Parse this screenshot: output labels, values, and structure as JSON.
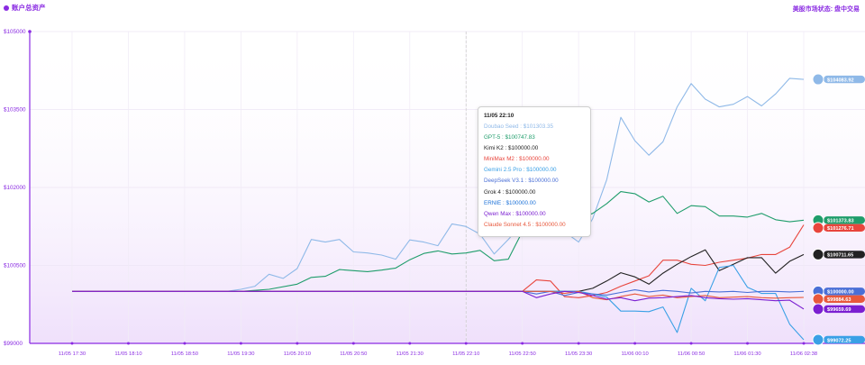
{
  "header": {
    "title": "账户总资产",
    "market_status": "美股市场状态: 盘中交易"
  },
  "tooltip": {
    "time": "11/05 22:10",
    "rows": [
      {
        "label": "Doubao Seed : $101303.35",
        "color": "#8fb9e8"
      },
      {
        "label": "GPT-5 : $100747.83",
        "color": "#1f9d6b"
      },
      {
        "label": "Kimi K2 : $100000.00",
        "color": "#222222"
      },
      {
        "label": "MiniMax M2 : $100000.00",
        "color": "#e8453c"
      },
      {
        "label": "Gemini 2.5 Pro : $100000.00",
        "color": "#3aa0e6"
      },
      {
        "label": "DeepSeek V3.1 : $100000.00",
        "color": "#4a6fd6"
      },
      {
        "label": "Grok 4 : $100000.00",
        "color": "#222222"
      },
      {
        "label": "ERNIE : $100000.00",
        "color": "#1e73d8"
      },
      {
        "label": "Qwen Max : $100000.00",
        "color": "#7b1fd1"
      },
      {
        "label": "Claude Sonnet 4.5 : $100000.00",
        "color": "#e8583c"
      }
    ]
  },
  "chart_data": {
    "type": "line",
    "ylim": [
      99000,
      105000
    ],
    "y_ticks": [
      "$105000",
      "$103500",
      "$102000",
      "$100500",
      "$99000"
    ],
    "x_ticks": [
      "11/05 17:30",
      "11/05 18:10",
      "11/05 18:50",
      "11/05 19:30",
      "11/05 20:10",
      "11/05 20:50",
      "11/05 21:30",
      "11/05 22:10",
      "11/05 22:50",
      "11/05 23:30",
      "11/06 00:10",
      "11/06 00:50",
      "11/06 01:30",
      "11/06 02:38"
    ],
    "series": [
      {
        "name": "Doubao Seed",
        "color": "#8fb9e8",
        "end_label": "$104083.92",
        "badge": "avatar",
        "x": [
          0,
          2.75,
          3,
          3.25,
          3.5,
          3.75,
          4,
          4.25,
          4.5,
          4.75,
          5,
          5.25,
          5.5,
          5.75,
          6,
          6.25,
          6.5,
          6.75,
          7,
          7.25,
          7.5,
          7.75,
          8,
          8.25,
          8.5,
          8.75,
          9,
          9.25,
          9.5,
          9.75,
          10,
          10.25,
          10.5,
          10.75,
          11,
          11.25,
          11.5,
          11.75,
          12,
          12.25,
          12.5,
          12.75,
          13
        ],
        "y": [
          100000,
          100000,
          100040,
          100100,
          100330,
          100250,
          100440,
          101000,
          100950,
          101000,
          100760,
          100740,
          100700,
          100620,
          100990,
          100950,
          100880,
          101300,
          101250,
          101100,
          100720,
          101000,
          101300,
          101280,
          101350,
          101150,
          100950,
          101400,
          102150,
          103350,
          102900,
          102620,
          102880,
          103550,
          104000,
          103700,
          103550,
          103600,
          103750,
          103570,
          103800,
          104100,
          104080
        ]
      },
      {
        "name": "GPT-5",
        "color": "#1f9d6b",
        "end_label": "$101373.83",
        "x": [
          0,
          3,
          3.5,
          4,
          4.25,
          4.5,
          4.75,
          5,
          5.25,
          5.5,
          5.75,
          6,
          6.25,
          6.5,
          6.75,
          7,
          7.25,
          7.5,
          7.75,
          8,
          8.25,
          8.5,
          8.75,
          9,
          9.25,
          9.5,
          9.75,
          10,
          10.25,
          10.5,
          10.75,
          11,
          11.25,
          11.5,
          11.75,
          12,
          12.25,
          12.5,
          12.75,
          13
        ],
        "y": [
          100000,
          100000,
          100040,
          100140,
          100270,
          100290,
          100420,
          100400,
          100380,
          100410,
          100450,
          100610,
          100730,
          100780,
          100720,
          100740,
          100790,
          100590,
          100620,
          101150,
          101300,
          101350,
          101380,
          101410,
          101500,
          101690,
          101920,
          101880,
          101720,
          101830,
          101500,
          101650,
          101630,
          101450,
          101450,
          101430,
          101500,
          101380,
          101340,
          101370
        ]
      },
      {
        "name": "MiniMax M2",
        "color": "#e8453c",
        "end_label": "$101276.71",
        "x": [
          0,
          8,
          8.25,
          8.5,
          8.75,
          9,
          9.25,
          9.5,
          9.75,
          10,
          10.25,
          10.5,
          10.75,
          11,
          11.25,
          11.5,
          11.75,
          12,
          12.25,
          12.5,
          12.75,
          13
        ],
        "y": [
          100000,
          100000,
          100220,
          100200,
          99900,
          99880,
          99920,
          99980,
          100100,
          100200,
          100300,
          100600,
          100600,
          100520,
          100500,
          100560,
          100600,
          100640,
          100710,
          100710,
          100850,
          101280
        ]
      },
      {
        "name": "Kimi K2",
        "color": "#222222",
        "end_label": "$100711.65",
        "badge": "kimi",
        "x": [
          0,
          9,
          9.25,
          9.5,
          9.75,
          10,
          10.25,
          10.5,
          10.75,
          11,
          11.25,
          11.5,
          11.75,
          12,
          12.25,
          12.5,
          12.75,
          13
        ],
        "y": [
          100000,
          100000,
          100060,
          100200,
          100360,
          100280,
          100140,
          100350,
          100520,
          100670,
          100800,
          100400,
          100520,
          100650,
          100650,
          100350,
          100580,
          100710
        ]
      },
      {
        "name": "Gemini 2.5 Pro",
        "color": "#3aa0e6",
        "end_label": "$99072.25",
        "badge": "gemini",
        "x": [
          0,
          9,
          9.25,
          9.5,
          9.75,
          10,
          10.25,
          10.5,
          10.75,
          11,
          11.25,
          11.5,
          11.75,
          12,
          12.25,
          12.5,
          12.75,
          13
        ],
        "y": [
          100000,
          100000,
          99950,
          99890,
          99620,
          99620,
          99610,
          99700,
          99210,
          100060,
          99820,
          100460,
          100500,
          100080,
          99960,
          99960,
          99370,
          99070
        ]
      },
      {
        "name": "DeepSeek V3.1",
        "color": "#4a6fd6",
        "end_label": "$100000.00",
        "x": [
          0,
          8,
          8.25,
          8.5,
          8.75,
          9,
          9.25,
          9.5,
          9.75,
          10,
          10.25,
          10.5,
          10.75,
          11,
          11.25,
          11.5,
          11.75,
          12,
          12.25,
          12.5,
          12.75,
          13
        ],
        "y": [
          100000,
          100000,
          99950,
          100000,
          99920,
          99980,
          99950,
          99930,
          99980,
          100030,
          99990,
          100020,
          100000,
          99970,
          100000,
          99990,
          100000,
          99980,
          100000,
          100000,
          99990,
          100000
        ]
      },
      {
        "name": "Claude Sonnet 4.5",
        "color": "#e8583c",
        "end_label": "$99884.63",
        "x": [
          0,
          8.5,
          8.75,
          9,
          9.25,
          9.5,
          9.75,
          10,
          10.25,
          10.5,
          10.75,
          11,
          11.25,
          11.5,
          11.75,
          12,
          12.25,
          12.5,
          12.75,
          13
        ],
        "y": [
          100000,
          100000,
          99960,
          100000,
          99880,
          99840,
          99900,
          99950,
          99900,
          99930,
          99880,
          99900,
          99920,
          99880,
          99890,
          99900,
          99880,
          99870,
          99880,
          99885
        ]
      },
      {
        "name": "Qwen Max",
        "color": "#7b1fd1",
        "end_label": "$99659.69",
        "x": [
          0,
          8,
          8.25,
          8.5,
          8.75,
          9,
          9.25,
          9.5,
          9.75,
          10,
          10.25,
          10.5,
          10.75,
          11,
          11.25,
          11.5,
          11.75,
          12,
          12.25,
          12.5,
          12.75,
          13
        ],
        "y": [
          100000,
          100000,
          99880,
          99950,
          100000,
          99980,
          99920,
          99850,
          99880,
          99820,
          99870,
          99880,
          99900,
          99920,
          99880,
          99860,
          99850,
          99860,
          99840,
          99820,
          99830,
          99660
        ]
      }
    ]
  }
}
